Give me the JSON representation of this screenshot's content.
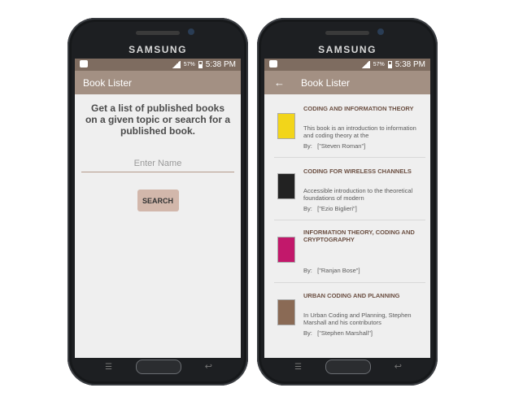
{
  "device": {
    "brand": "SAMSUNG"
  },
  "status": {
    "battery": "57%",
    "time": "5:38 PM"
  },
  "search_screen": {
    "app_title": "Book Lister",
    "prompt": "Get a list of published books on a given topic or search for a published book.",
    "input_placeholder": "Enter Name",
    "search_label": "SEARCH"
  },
  "results_screen": {
    "app_title": "Book Lister",
    "books": [
      {
        "title": "CODING AND INFORMATION THEORY",
        "description": "This book is an introduction to information and coding theory at the",
        "by_label": "By:",
        "authors": "[\"Steven Roman\"]",
        "cover_color": "#f2d51a"
      },
      {
        "title": "CODING FOR WIRELESS CHANNELS",
        "description": "Accessible introduction to the theoretical foundations of modern",
        "by_label": "By:",
        "authors": "[\"Ezio Biglieri\"]",
        "cover_color": "#222222"
      },
      {
        "title": "INFORMATION THEORY, CODING AND CRYPTOGRAPHY",
        "description": "",
        "by_label": "By:",
        "authors": "[\"Ranjan Bose\"]",
        "cover_color": "#c2186b"
      },
      {
        "title": "URBAN CODING AND PLANNING",
        "description": "In Urban Coding and Planning, Stephen Marshall and his contributors",
        "by_label": "By:",
        "authors": "[\"Stephen Marshall\"]",
        "cover_color": "#8a6a55"
      }
    ]
  },
  "colors": {
    "status_bar": "#7e6c60",
    "app_bar": "#a39083",
    "search_button": "#d2b7ab",
    "title_text": "#6b4f42"
  }
}
